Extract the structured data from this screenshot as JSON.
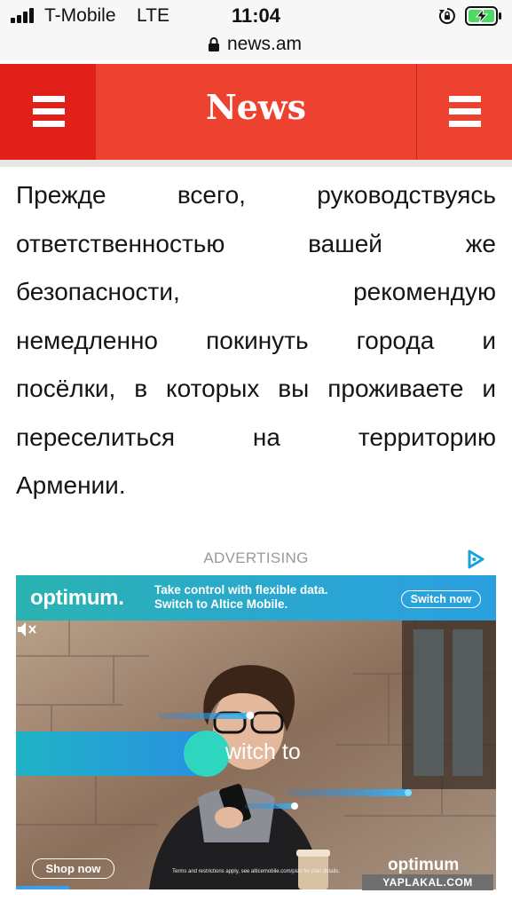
{
  "status_bar": {
    "carrier": "T-Mobile",
    "network": "LTE",
    "time": "11:04",
    "icons": [
      "signal-bars-icon",
      "rotation-lock-icon",
      "battery-charging-icon"
    ]
  },
  "browser": {
    "domain": "news.am",
    "secure_icon": "lock-icon"
  },
  "site_header": {
    "logo": "News",
    "left_menu_icon": "hamburger-menu-icon",
    "right_menu_icon": "hamburger-menu-icon",
    "colors": {
      "header": "#ee4231",
      "left_button": "#e1201a"
    }
  },
  "article": {
    "lines": [
      [
        "Прежде",
        "всего,",
        "руководствуясь"
      ],
      [
        "ответственностью",
        "вашей",
        "же"
      ],
      [
        "безопасности,",
        "рекомендую"
      ],
      [
        "немедленно",
        "покинуть",
        "города",
        "и"
      ],
      [
        "посёлки,",
        "в",
        "которых",
        "вы",
        "проживаете",
        "и"
      ],
      [
        "переселиться",
        "на",
        "территорию"
      ],
      [
        "Армении."
      ]
    ]
  },
  "advertising": {
    "label": "ADVERTISING",
    "choices_icon": "adchoices-icon",
    "banner": {
      "brand": "optimum.",
      "tagline_1": "Take control with flexible data.",
      "tagline_2": "Switch to Altice Mobile.",
      "cta": "Switch now"
    },
    "video": {
      "overlay_text": "witch to",
      "shop_button": "Shop now",
      "fine_print": "Terms and restrictions apply, see alticemobile.com/plan for plan details.",
      "brand": "optimum",
      "mute_icon": "speaker-muted-icon",
      "progress": 0.11
    }
  },
  "watermark": "YAPLAKAL.COM"
}
